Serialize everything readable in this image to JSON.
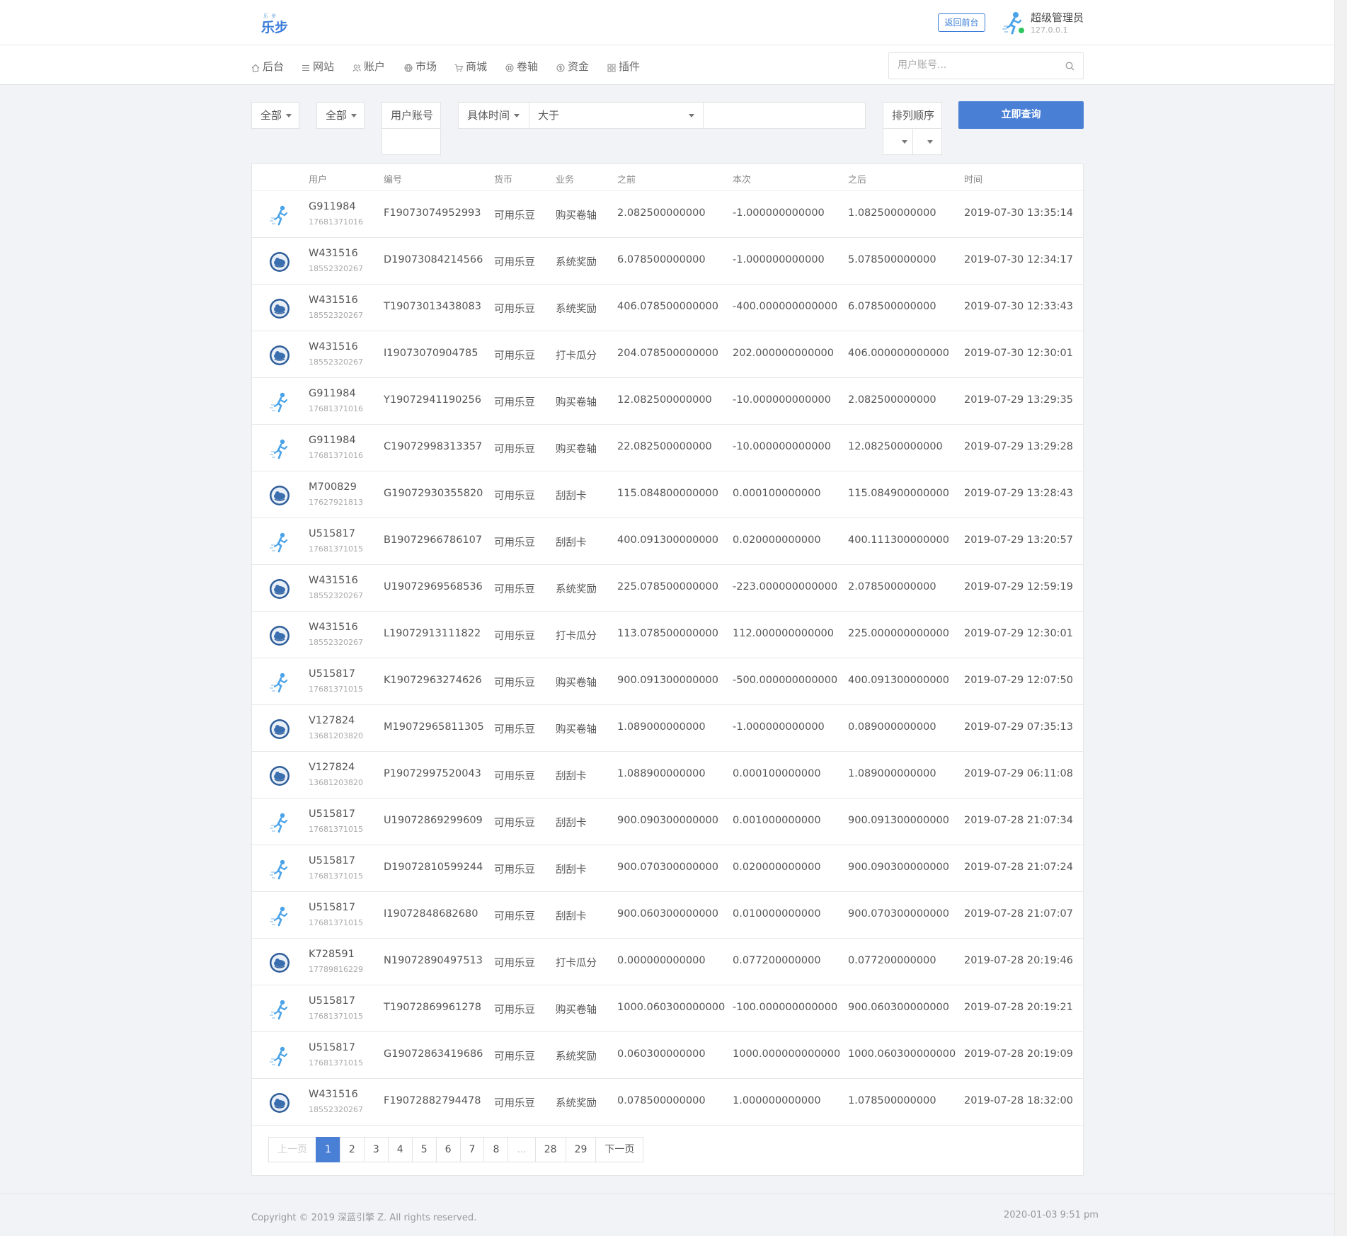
{
  "header": {
    "logo_small": "乐 步",
    "logo_text": "乐步",
    "back_button": "返回前台",
    "admin_name": "超级管理员",
    "admin_ip": "127.0.0.1"
  },
  "nav": {
    "items": [
      {
        "label": "后台",
        "icon": "home-icon"
      },
      {
        "label": "网站",
        "icon": "list-icon"
      },
      {
        "label": "账户",
        "icon": "users-icon"
      },
      {
        "label": "市场",
        "icon": "globe-icon"
      },
      {
        "label": "商城",
        "icon": "cart-icon"
      },
      {
        "label": "卷轴",
        "icon": "scroll-icon"
      },
      {
        "label": "资金",
        "icon": "money-icon"
      },
      {
        "label": "插件",
        "icon": "grid-icon"
      }
    ],
    "search_placeholder": "用户账号..."
  },
  "filters": {
    "select1": "全部",
    "select2": "全部",
    "account_label": "用户账号",
    "time_select": "具体时间",
    "compare_select": "大于",
    "time_value": "",
    "sort_label": "排列顺序",
    "query_button": "立即查询"
  },
  "table": {
    "columns": [
      "用户",
      "编号",
      "货币",
      "业务",
      "之前",
      "本次",
      "之后",
      "时间"
    ],
    "rows": [
      {
        "user": "G911984",
        "phone": "17681371016",
        "avatar": "runner",
        "no": "F19073074952993",
        "currency": "可用乐豆",
        "biz": "购买卷轴",
        "before": "2.082500000000",
        "amount": "-1.000000000000",
        "after": "1.082500000000",
        "time": "2019-07-30 13:35:14"
      },
      {
        "user": "W431516",
        "phone": "18552320267",
        "avatar": "circle",
        "no": "D19073084214566",
        "currency": "可用乐豆",
        "biz": "系统奖励",
        "before": "6.078500000000",
        "amount": "-1.000000000000",
        "after": "5.078500000000",
        "time": "2019-07-30 12:34:17"
      },
      {
        "user": "W431516",
        "phone": "18552320267",
        "avatar": "circle",
        "no": "T19073013438083",
        "currency": "可用乐豆",
        "biz": "系统奖励",
        "before": "406.078500000000",
        "amount": "-400.000000000000",
        "after": "6.078500000000",
        "time": "2019-07-30 12:33:43"
      },
      {
        "user": "W431516",
        "phone": "18552320267",
        "avatar": "circle",
        "no": "I19073070904785",
        "currency": "可用乐豆",
        "biz": "打卡瓜分",
        "before": "204.078500000000",
        "amount": "202.000000000000",
        "after": "406.000000000000",
        "time": "2019-07-30 12:30:01"
      },
      {
        "user": "G911984",
        "phone": "17681371016",
        "avatar": "runner",
        "no": "Y19072941190256",
        "currency": "可用乐豆",
        "biz": "购买卷轴",
        "before": "12.082500000000",
        "amount": "-10.000000000000",
        "after": "2.082500000000",
        "time": "2019-07-29 13:29:35"
      },
      {
        "user": "G911984",
        "phone": "17681371016",
        "avatar": "runner",
        "no": "C19072998313357",
        "currency": "可用乐豆",
        "biz": "购买卷轴",
        "before": "22.082500000000",
        "amount": "-10.000000000000",
        "after": "12.082500000000",
        "time": "2019-07-29 13:29:28"
      },
      {
        "user": "M700829",
        "phone": "17627921813",
        "avatar": "circle",
        "no": "G19072930355820",
        "currency": "可用乐豆",
        "biz": "刮刮卡",
        "before": "115.084800000000",
        "amount": "0.000100000000",
        "after": "115.084900000000",
        "time": "2019-07-29 13:28:43"
      },
      {
        "user": "U515817",
        "phone": "17681371015",
        "avatar": "runner",
        "no": "B19072966786107",
        "currency": "可用乐豆",
        "biz": "刮刮卡",
        "before": "400.091300000000",
        "amount": "0.020000000000",
        "after": "400.111300000000",
        "time": "2019-07-29 13:20:57"
      },
      {
        "user": "W431516",
        "phone": "18552320267",
        "avatar": "circle",
        "no": "U19072969568536",
        "currency": "可用乐豆",
        "biz": "系统奖励",
        "before": "225.078500000000",
        "amount": "-223.000000000000",
        "after": "2.078500000000",
        "time": "2019-07-29 12:59:19"
      },
      {
        "user": "W431516",
        "phone": "18552320267",
        "avatar": "circle",
        "no": "L19072913111822",
        "currency": "可用乐豆",
        "biz": "打卡瓜分",
        "before": "113.078500000000",
        "amount": "112.000000000000",
        "after": "225.000000000000",
        "time": "2019-07-29 12:30:01"
      },
      {
        "user": "U515817",
        "phone": "17681371015",
        "avatar": "runner",
        "no": "K19072963274626",
        "currency": "可用乐豆",
        "biz": "购买卷轴",
        "before": "900.091300000000",
        "amount": "-500.000000000000",
        "after": "400.091300000000",
        "time": "2019-07-29 12:07:50"
      },
      {
        "user": "V127824",
        "phone": "13681203820",
        "avatar": "circle",
        "no": "M19072965811305",
        "currency": "可用乐豆",
        "biz": "购买卷轴",
        "before": "1.089000000000",
        "amount": "-1.000000000000",
        "after": "0.089000000000",
        "time": "2019-07-29 07:35:13"
      },
      {
        "user": "V127824",
        "phone": "13681203820",
        "avatar": "circle",
        "no": "P19072997520043",
        "currency": "可用乐豆",
        "biz": "刮刮卡",
        "before": "1.088900000000",
        "amount": "0.000100000000",
        "after": "1.089000000000",
        "time": "2019-07-29 06:11:08"
      },
      {
        "user": "U515817",
        "phone": "17681371015",
        "avatar": "runner",
        "no": "U19072869299609",
        "currency": "可用乐豆",
        "biz": "刮刮卡",
        "before": "900.090300000000",
        "amount": "0.001000000000",
        "after": "900.091300000000",
        "time": "2019-07-28 21:07:34"
      },
      {
        "user": "U515817",
        "phone": "17681371015",
        "avatar": "runner",
        "no": "D19072810599244",
        "currency": "可用乐豆",
        "biz": "刮刮卡",
        "before": "900.070300000000",
        "amount": "0.020000000000",
        "after": "900.090300000000",
        "time": "2019-07-28 21:07:24"
      },
      {
        "user": "U515817",
        "phone": "17681371015",
        "avatar": "runner",
        "no": "I19072848682680",
        "currency": "可用乐豆",
        "biz": "刮刮卡",
        "before": "900.060300000000",
        "amount": "0.010000000000",
        "after": "900.070300000000",
        "time": "2019-07-28 21:07:07"
      },
      {
        "user": "K728591",
        "phone": "17789816229",
        "avatar": "circle",
        "no": "N19072890497513",
        "currency": "可用乐豆",
        "biz": "打卡瓜分",
        "before": "0.000000000000",
        "amount": "0.077200000000",
        "after": "0.077200000000",
        "time": "2019-07-28 20:19:46"
      },
      {
        "user": "U515817",
        "phone": "17681371015",
        "avatar": "runner",
        "no": "T19072869961278",
        "currency": "可用乐豆",
        "biz": "购买卷轴",
        "before": "1000.060300000000",
        "amount": "-100.000000000000",
        "after": "900.060300000000",
        "time": "2019-07-28 20:19:21"
      },
      {
        "user": "U515817",
        "phone": "17681371015",
        "avatar": "runner",
        "no": "G19072863419686",
        "currency": "可用乐豆",
        "biz": "系统奖励",
        "before": "0.060300000000",
        "amount": "1000.000000000000",
        "after": "1000.060300000000",
        "time": "2019-07-28 20:19:09"
      },
      {
        "user": "W431516",
        "phone": "18552320267",
        "avatar": "circle",
        "no": "F19072882794478",
        "currency": "可用乐豆",
        "biz": "系统奖励",
        "before": "0.078500000000",
        "amount": "1.000000000000",
        "after": "1.078500000000",
        "time": "2019-07-28 18:32:00"
      }
    ]
  },
  "pagination": {
    "prev": "上一页",
    "pages": [
      "1",
      "2",
      "3",
      "4",
      "5",
      "6",
      "7",
      "8",
      "...",
      "28",
      "29"
    ],
    "current": "1",
    "next": "下一页"
  },
  "footer": {
    "copyright": "Copyright © 2019 深蓝引擎 Z. All rights reserved.",
    "datetime": "2020-01-03 9:51 pm"
  },
  "colors": {
    "accent": "#4a7fd6",
    "online": "#2ec55f"
  }
}
